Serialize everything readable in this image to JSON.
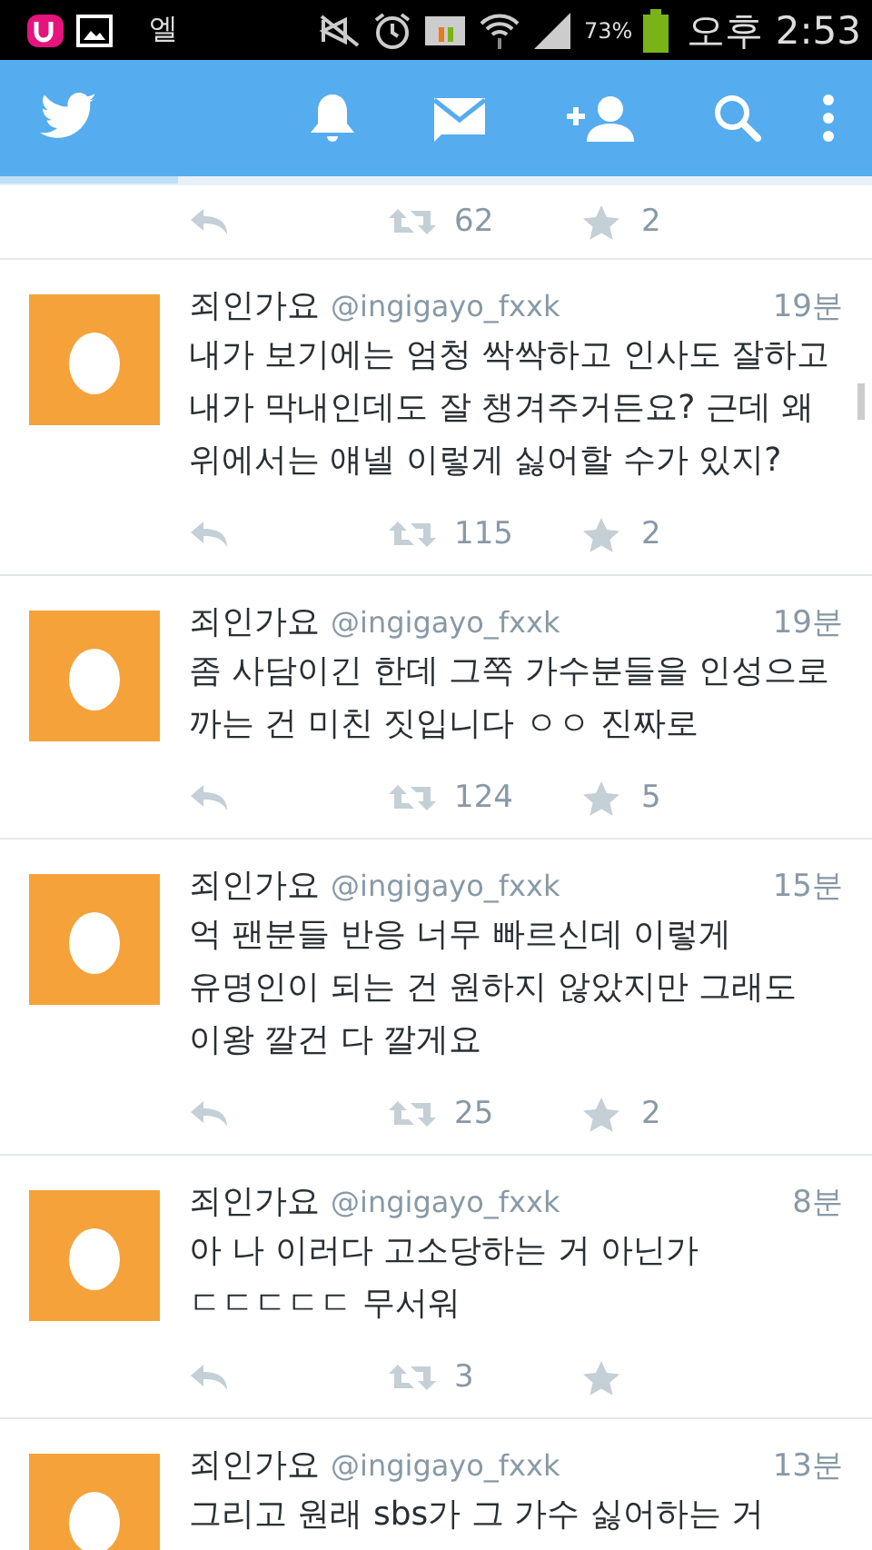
{
  "status_bar": {
    "carrier_text": "엘",
    "battery": "73%",
    "time": "오후 2:53"
  },
  "top_tweet_actions": {
    "retweets": "62",
    "favorites": "2"
  },
  "tweets": [
    {
      "name": "죄인가요",
      "handle": "@ingigayo_fxxk",
      "time": "19분",
      "lines": [
        "내가 보기에는 엄청 싹싹하고 인사도 잘하고",
        "내가 막내인데도 잘 챙겨주거든요? 근데 왜",
        "위에서는 얘넬 이렇게 싫어할 수가 있지?"
      ],
      "retweets": "115",
      "favorites": "2"
    },
    {
      "name": "죄인가요",
      "handle": "@ingigayo_fxxk",
      "time": "19분",
      "lines": [
        "좀 사담이긴 한데 그쪽 가수분들을 인성으로",
        "까는 건 미친 짓입니다 ㅇㅇ 진짜로"
      ],
      "retweets": "124",
      "favorites": "5"
    },
    {
      "name": "죄인가요",
      "handle": "@ingigayo_fxxk",
      "time": "15분",
      "lines": [
        "억 팬분들 반응 너무 빠르신데 이렇게",
        "유명인이 되는 건 원하지 않았지만 그래도",
        "이왕 깔건 다 깔게요"
      ],
      "retweets": "25",
      "favorites": "2"
    },
    {
      "name": "죄인가요",
      "handle": "@ingigayo_fxxk",
      "time": "8분",
      "lines": [
        "아 나 이러다 고소당하는 거 아닌가",
        "ㄷㄷㄷㄷㄷ 무서워"
      ],
      "retweets": "3"
    },
    {
      "name": "죄인가요",
      "handle": "@ingigayo_fxxk",
      "time": "13분",
      "lines": [
        "그리고 원래 sbs가 그 가수 싫어하는 거"
      ]
    }
  ]
}
